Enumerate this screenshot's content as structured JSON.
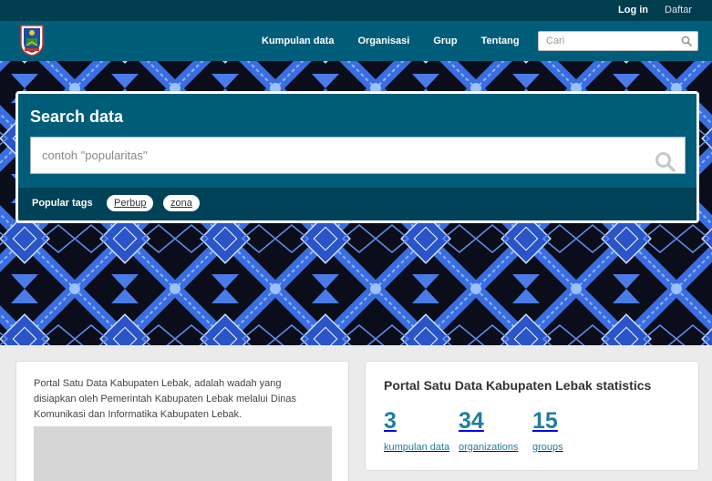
{
  "account": {
    "login": "Log in",
    "register": "Daftar"
  },
  "nav": {
    "datasets": "Kumpulan data",
    "organizations": "Organisasi",
    "groups": "Grup",
    "about": "Tentang"
  },
  "site_search": {
    "placeholder": "Cari"
  },
  "hero": {
    "title": "Search data",
    "query_placeholder": "contoh \"popularitas\"",
    "popular_tags_label": "Popular tags",
    "tags": [
      "Perbup",
      "zona"
    ]
  },
  "intro": {
    "text": "Portal Satu Data Kabupaten Lebak, adalah wadah yang disiapkan oleh Pemerintah Kabupaten Lebak melalui Dinas Komunikasi dan Informatika Kabupaten Lebak."
  },
  "stats": {
    "title": "Portal Satu Data Kabupaten Lebak statistics",
    "items": [
      {
        "value": "3",
        "label": "kumpulan data"
      },
      {
        "value": "34",
        "label": "organizations"
      },
      {
        "value": "15",
        "label": "groups"
      }
    ]
  },
  "colors": {
    "header": "#005d7a",
    "account_bar": "#003d4f",
    "accent": "#1e7ea1",
    "batik_blue": "#3a6ee0"
  },
  "icons": {
    "logo": "regency-crest",
    "search": "search-icon"
  }
}
